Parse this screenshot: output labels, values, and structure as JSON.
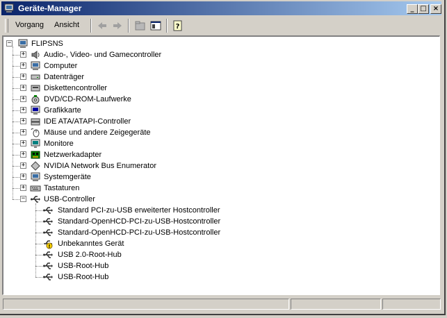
{
  "window": {
    "title": "Geräte-Manager"
  },
  "menu": {
    "vorgang": "Vorgang",
    "ansicht": "Ansicht"
  },
  "tree": {
    "root": "FLIPSNS",
    "categories": [
      {
        "label": "Audio-, Video- und Gamecontroller",
        "icon": "sound-icon"
      },
      {
        "label": "Computer",
        "icon": "computer-icon"
      },
      {
        "label": "Datenträger",
        "icon": "disk-drive-icon"
      },
      {
        "label": "Diskettencontroller",
        "icon": "floppy-controller-icon"
      },
      {
        "label": "DVD/CD-ROM-Laufwerke",
        "icon": "cdrom-icon"
      },
      {
        "label": "Grafikkarte",
        "icon": "display-adapter-icon"
      },
      {
        "label": "IDE ATA/ATAPI-Controller",
        "icon": "ide-controller-icon"
      },
      {
        "label": "Mäuse und andere Zeigegeräte",
        "icon": "mouse-icon"
      },
      {
        "label": "Monitore",
        "icon": "monitor-icon"
      },
      {
        "label": "Netzwerkadapter",
        "icon": "network-adapter-icon"
      },
      {
        "label": "NVIDIA Network Bus Enumerator",
        "icon": "bus-icon"
      },
      {
        "label": "Systemgeräte",
        "icon": "system-device-icon"
      },
      {
        "label": "Tastaturen",
        "icon": "keyboard-icon"
      }
    ],
    "usb": {
      "label": "USB-Controller",
      "children": [
        {
          "label": "Standard PCI-zu-USB erweiterter Hostcontroller",
          "icon": "usb-icon"
        },
        {
          "label": "Standard-OpenHCD-PCI-zu-USB-Hostcontroller",
          "icon": "usb-icon"
        },
        {
          "label": "Standard-OpenHCD-PCI-zu-USB-Hostcontroller",
          "icon": "usb-icon"
        },
        {
          "label": "Unbekanntes Gerät",
          "icon": "usb-warning-icon"
        },
        {
          "label": "USB 2.0-Root-Hub",
          "icon": "usb-icon"
        },
        {
          "label": "USB-Root-Hub",
          "icon": "usb-icon"
        },
        {
          "label": "USB-Root-Hub",
          "icon": "usb-icon"
        }
      ]
    }
  },
  "colors": {
    "titlebar_start": "#0a246a",
    "titlebar_end": "#a6caf0",
    "face": "#d4d0c8"
  }
}
